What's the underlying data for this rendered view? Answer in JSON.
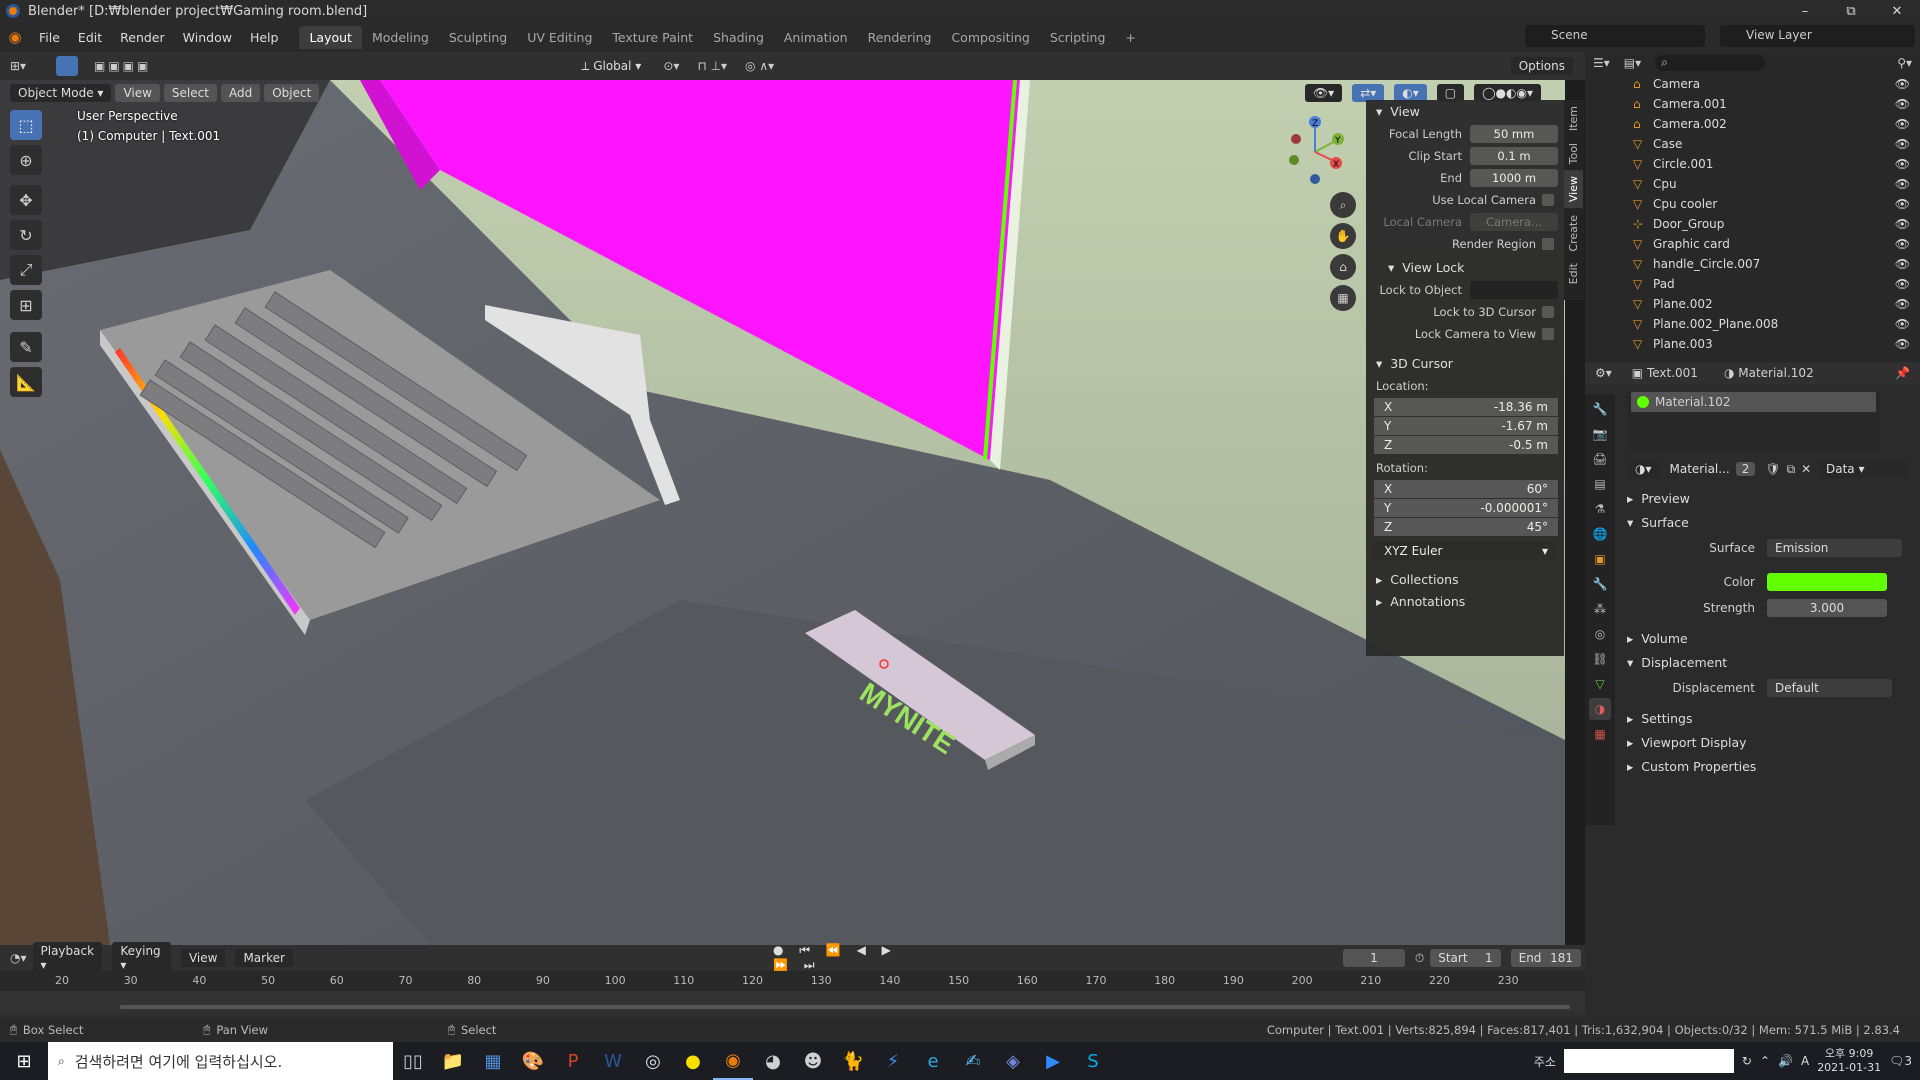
{
  "window": {
    "title": "Blender* [D:₩blender project₩Gaming room.blend]",
    "minimize": "–",
    "restore": "⧉",
    "close": "✕"
  },
  "menu": [
    "File",
    "Edit",
    "Render",
    "Window",
    "Help"
  ],
  "workspaces": [
    "Layout",
    "Modeling",
    "Sculpting",
    "UV Editing",
    "Texture Paint",
    "Shading",
    "Animation",
    "Rendering",
    "Compositing",
    "Scripting"
  ],
  "active_workspace": "Layout",
  "add_workspace": "+",
  "scene": "Scene",
  "view_layer": "View Layer",
  "toolbar": {
    "orientation": "Global",
    "options": "Options"
  },
  "viewport_header": {
    "mode": "Object Mode",
    "view": "View",
    "select": "Select",
    "add": "Add",
    "object": "Object"
  },
  "viewport_overlay": {
    "perspective": "User Perspective",
    "object": "(1) Computer | Text.001"
  },
  "scene_text": "MYNITE",
  "npanel": {
    "tabs": [
      "Item",
      "Tool",
      "View",
      "Create",
      "Edit"
    ],
    "view_header": "View",
    "focal_length_label": "Focal Length",
    "focal_length": "50 mm",
    "clip_start_label": "Clip Start",
    "clip_start": "0.1 m",
    "end_label": "End",
    "end": "1000 m",
    "use_local_camera": "Use Local Camera",
    "local_camera_label": "Local Camera",
    "local_camera": "Camera...",
    "render_region": "Render Region",
    "view_lock_header": "View Lock",
    "lock_to_object": "Lock to Object",
    "lock_to_3d_cursor": "Lock to 3D Cursor",
    "lock_camera_to_view": "Lock Camera to View",
    "cursor_header": "3D Cursor",
    "location_label": "Location:",
    "loc_x": "-18.36 m",
    "loc_y": "-1.67 m",
    "loc_z": "-0.5 m",
    "rotation_label": "Rotation:",
    "rot_x": "60°",
    "rot_y": "-0.000001°",
    "rot_z": "45°",
    "rotation_mode": "XYZ Euler",
    "collections": "Collections",
    "annotations": "Annotations",
    "axis_labels": {
      "x": "X",
      "y": "Y",
      "z": "Z"
    }
  },
  "outliner": [
    {
      "name": "Camera",
      "icon": "camera-icon"
    },
    {
      "name": "Camera.001",
      "icon": "camera-icon"
    },
    {
      "name": "Camera.002",
      "icon": "camera-icon"
    },
    {
      "name": "Case",
      "icon": "mesh-icon"
    },
    {
      "name": "Circle.001",
      "icon": "mesh-icon"
    },
    {
      "name": "Cpu",
      "icon": "mesh-icon"
    },
    {
      "name": "Cpu cooler",
      "icon": "mesh-icon"
    },
    {
      "name": "Door_Group",
      "icon": "empty-icon"
    },
    {
      "name": "Graphic card",
      "icon": "mesh-icon"
    },
    {
      "name": "handle_Circle.007",
      "icon": "mesh-icon"
    },
    {
      "name": "Pad",
      "icon": "mesh-icon"
    },
    {
      "name": "Plane.002",
      "icon": "mesh-icon"
    },
    {
      "name": "Plane.002_Plane.008",
      "icon": "mesh-icon"
    },
    {
      "name": "Plane.003",
      "icon": "mesh-icon"
    }
  ],
  "properties": {
    "breadcrumb_object": "Text.001",
    "breadcrumb_material": "Material.102",
    "slot": "Material.102",
    "material_name": "Material...",
    "users": "2",
    "link": "Data",
    "sections": {
      "preview": "Preview",
      "surface": "Surface",
      "volume": "Volume",
      "displacement": "Displacement",
      "settings": "Settings",
      "viewport_display": "Viewport Display",
      "custom_properties": "Custom Properties"
    },
    "surface_label": "Surface",
    "surface_value": "Emission",
    "color_label": "Color",
    "color_value": "#62ff00",
    "strength_label": "Strength",
    "strength_value": "3.000",
    "displacement_label": "Displacement",
    "displacement_value": "Default"
  },
  "timeline": {
    "playback": "Playback",
    "keying": "Keying",
    "view": "View",
    "marker": "Marker",
    "current_frame": "1",
    "start_label": "Start",
    "start": "1",
    "end_label": "End",
    "end": "181",
    "ticks": [
      "20",
      "30",
      "40",
      "50",
      "60",
      "70",
      "80",
      "90",
      "100",
      "110",
      "120",
      "130",
      "140",
      "150",
      "160",
      "170",
      "180",
      "190",
      "200",
      "210",
      "220",
      "230"
    ]
  },
  "status": {
    "box_select": "Box Select",
    "pan_view": "Pan View",
    "select": "Select",
    "info": "Computer | Text.001 | Verts:825,894 | Faces:817,401 | Tris:1,632,904 | Objects:0/32 | Mem: 571.5 MiB | 2.83.4"
  },
  "taskbar": {
    "search_placeholder": "검색하려면 여기에 입력하십시오.",
    "address_label": "주소",
    "time": "오후 9:09",
    "date": "2021-01-31",
    "ime": "A",
    "notification_count": "3"
  }
}
